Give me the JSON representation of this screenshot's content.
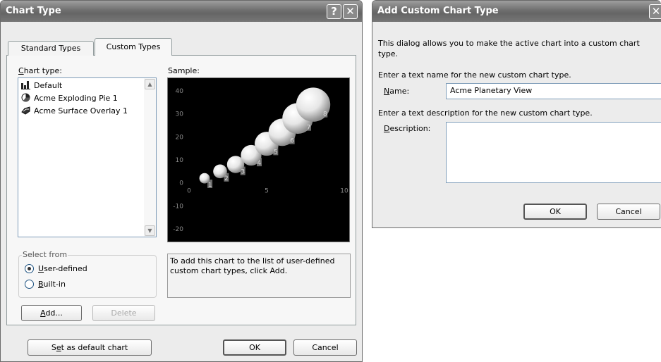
{
  "chart_type_dialog": {
    "title": "Chart Type",
    "help_btn": "?",
    "close_btn": "✕",
    "tabs": [
      "Standard Types",
      "Custom Types"
    ],
    "chart_type_label": "Chart type:",
    "chart_types": [
      "Default",
      "Acme Exploding Pie 1",
      "Acme Surface Overlay 1"
    ],
    "sample_label": "Sample:",
    "select_from_label": "Select from",
    "radio_user_defined": "User-defined",
    "radio_built_in": "Built-in",
    "selected_source": "User-defined",
    "add_btn": "Add...",
    "delete_btn": "Delete",
    "description": "To add this chart to the list of user-defined custom chart types, click Add.",
    "set_default_btn": "Set as default chart",
    "ok_btn": "OK",
    "cancel_btn": "Cancel"
  },
  "sample_chart": {
    "background": "#000000",
    "y_ticks": [
      "40",
      "30",
      "20",
      "10",
      "0",
      "-10",
      "-20"
    ],
    "x_ticks": [
      "0",
      "5",
      "10"
    ]
  },
  "chart_data": {
    "type": "scatter",
    "x": [
      1,
      2,
      3,
      4,
      5,
      6,
      7,
      8
    ],
    "y": [
      2,
      5,
      8,
      12,
      17,
      22,
      28,
      34
    ],
    "size": [
      1,
      2,
      3,
      4,
      5,
      6,
      7,
      8
    ],
    "point_labels": [
      "1",
      "2",
      "3",
      "4",
      "5",
      "6",
      "7",
      "8"
    ],
    "xlim": [
      0,
      10
    ],
    "ylim": [
      -20,
      40
    ],
    "grid": false,
    "legend": "none"
  },
  "add_custom_dialog": {
    "title": "Add Custom Chart Type",
    "close_btn": "✕",
    "intro": "This dialog allows you to make the active chart into a custom chart type.",
    "name_prompt": "Enter a text name for the new custom chart type.",
    "name_label": "Name:",
    "name_value": "Acme Planetary View",
    "desc_prompt": "Enter a text description for the new custom chart type.",
    "desc_label": "Description:",
    "desc_value": "",
    "ok_btn": "OK",
    "cancel_btn": "Cancel"
  }
}
